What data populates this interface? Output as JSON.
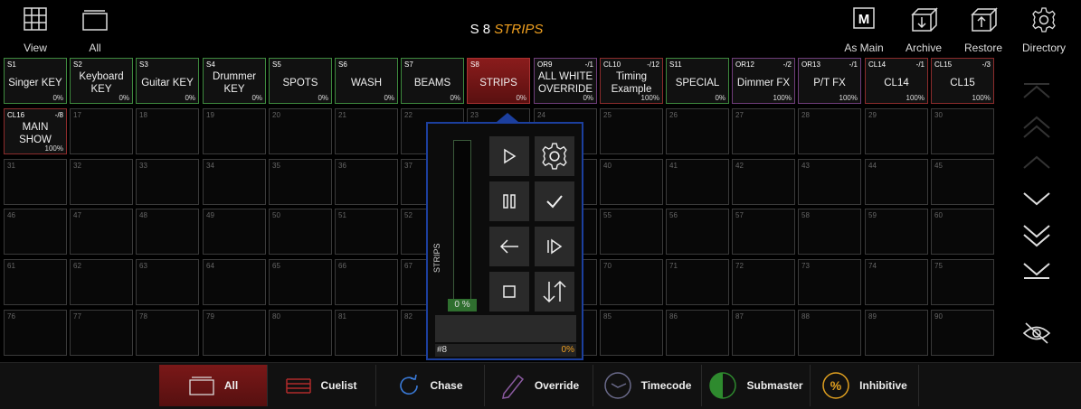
{
  "header": {
    "left_buttons": [
      {
        "label": "View",
        "icon": "grid-icon"
      },
      {
        "label": "All",
        "icon": "folder-icon"
      }
    ],
    "title_prefix": "S 8",
    "title_name": "STRIPS",
    "right_buttons": [
      {
        "label": "As Main",
        "icon": "m-box-icon"
      },
      {
        "label": "Archive",
        "icon": "archive-box-icon"
      },
      {
        "label": "Restore",
        "icon": "restore-box-icon"
      },
      {
        "label": "Directory",
        "icon": "gear-icon"
      }
    ]
  },
  "playbacks": [
    {
      "num": "S1",
      "name": "Singer KEY",
      "pct": "0%",
      "range": "",
      "style": "green"
    },
    {
      "num": "S2",
      "name": "Keyboard KEY",
      "pct": "0%",
      "range": "",
      "style": "green"
    },
    {
      "num": "S3",
      "name": "Guitar KEY",
      "pct": "0%",
      "range": "",
      "style": "green"
    },
    {
      "num": "S4",
      "name": "Drummer KEY",
      "pct": "0%",
      "range": "",
      "style": "green"
    },
    {
      "num": "S5",
      "name": "SPOTS",
      "pct": "0%",
      "range": "",
      "style": "green"
    },
    {
      "num": "S6",
      "name": "WASH",
      "pct": "0%",
      "range": "",
      "style": "green"
    },
    {
      "num": "S7",
      "name": "BEAMS",
      "pct": "0%",
      "range": "",
      "style": "green"
    },
    {
      "num": "S8",
      "name": "STRIPS",
      "pct": "0%",
      "range": "",
      "style": "active"
    },
    {
      "num": "OR9",
      "name": "ALL WHITE OVERRIDE",
      "pct": "0%",
      "range": "-/1",
      "style": "purple"
    },
    {
      "num": "CL10",
      "name": "Timing Example",
      "pct": "100%",
      "range": "-/12",
      "style": "red"
    },
    {
      "num": "S11",
      "name": "SPECIAL",
      "pct": "0%",
      "range": "",
      "style": "green"
    },
    {
      "num": "OR12",
      "name": "Dimmer FX",
      "pct": "100%",
      "range": "-/2",
      "style": "purple"
    },
    {
      "num": "OR13",
      "name": "P/T FX",
      "pct": "100%",
      "range": "-/1",
      "style": "purple"
    },
    {
      "num": "CL14",
      "name": "CL14",
      "pct": "100%",
      "range": "-/1",
      "style": "red"
    },
    {
      "num": "CL15",
      "name": "CL15",
      "pct": "100%",
      "range": "-/3",
      "style": "red"
    },
    {
      "num": "CL16",
      "name": "MAIN SHOW",
      "pct": "100%",
      "range": "-/8",
      "style": "red"
    }
  ],
  "empty_cells_count_label": "90",
  "popup": {
    "fader_label": "STRIPS",
    "fader_value": "0 %",
    "footer_left": "#8",
    "footer_right": "0%",
    "buttons": [
      "play-icon",
      "gear-icon",
      "pause-icon",
      "check-icon",
      "back-arrow-icon",
      "step-forward-icon",
      "stop-icon",
      "swap-arrows-icon"
    ]
  },
  "bottom_bar": [
    {
      "label": "All",
      "icon": "pages-icon",
      "active": true
    },
    {
      "label": "Cuelist",
      "icon": "list-lines-icon",
      "active": false
    },
    {
      "label": "Chase",
      "icon": "refresh-icon",
      "active": false
    },
    {
      "label": "Override",
      "icon": "pen-icon",
      "active": false
    },
    {
      "label": "Timecode",
      "icon": "clock-icon",
      "active": false
    },
    {
      "label": "Submaster",
      "icon": "half-circle-icon",
      "active": false
    },
    {
      "label": "Inhibitive",
      "icon": "percent-circle-icon",
      "active": false
    }
  ],
  "colors": {
    "accent_orange": "#f0a020",
    "active_red": "#8a1c1c",
    "popup_border": "#1c3f9e",
    "green_border": "#3e8a3e"
  }
}
